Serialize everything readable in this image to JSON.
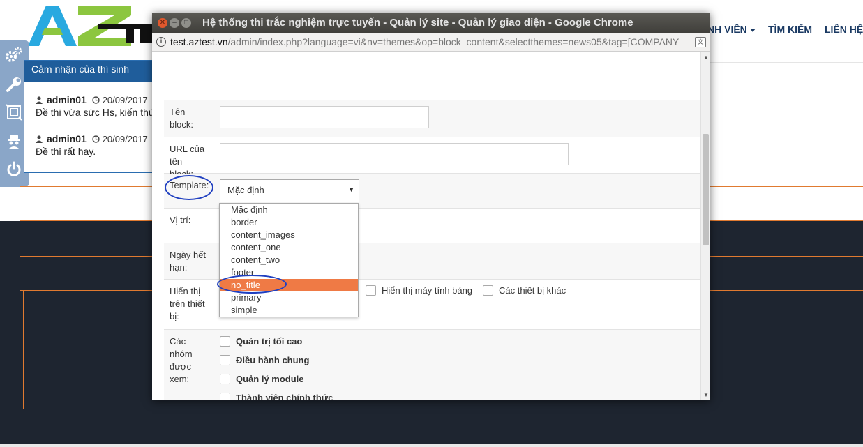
{
  "site": {
    "nav": [
      {
        "label": "NH VIÊN",
        "has_caret": true
      },
      {
        "label": "TÌM KIẾM",
        "has_caret": false
      },
      {
        "label": "LIÊN HỆ",
        "has_caret": false
      }
    ],
    "toolbar_icons": [
      "gears-icon",
      "wrench-icon",
      "layout-icon",
      "spy-icon",
      "power-icon"
    ]
  },
  "review_panel": {
    "title": "Cảm nhận của thí sinh",
    "items": [
      {
        "user": "admin01",
        "date": "20/09/2017",
        "text": "Đề thi vừa sức Hs, kiến thức"
      },
      {
        "user": "admin01",
        "date": "20/09/2017",
        "text": "Đề thi rất hay."
      }
    ]
  },
  "popup": {
    "title": "Hệ thống thi trắc nghiệm trực tuyến - Quản lý site - Quản lý giao diện - Google Chrome",
    "url_host": "test.aztest.vn",
    "url_rest": "/admin/index.php?language=vi&nv=themes&op=block_content&selectthemes=news05&tag=[COMPANY",
    "form": {
      "block_name_label": "Tên block:",
      "block_url_label": "URL của tên block:",
      "template_label": "Template:",
      "template_value": "Mặc định",
      "position_label": "Vị trí:",
      "expiry_label": "Ngày hết hạn:",
      "device_label": "Hiển thị trên thiết bị:",
      "device_options": [
        "Hiển thị máy tính bảng",
        "Các thiết bị khác"
      ],
      "groups_label": "Các nhóm được xem:",
      "groups": [
        "Quản trị tối cao",
        "Điều hành chung",
        "Quản lý module",
        "Thành viên chính thức"
      ]
    },
    "template_options": [
      "Mặc định",
      "border",
      "content_images",
      "content_one",
      "content_two",
      "footer",
      "no_title",
      "primary",
      "simple"
    ],
    "highlighted_option": "no_title"
  },
  "colors": {
    "accent_orange": "#ef7a45",
    "nav_blue": "#1b3a63",
    "annotation_blue": "#1f3fc0",
    "footer_dark": "#1e2530"
  }
}
